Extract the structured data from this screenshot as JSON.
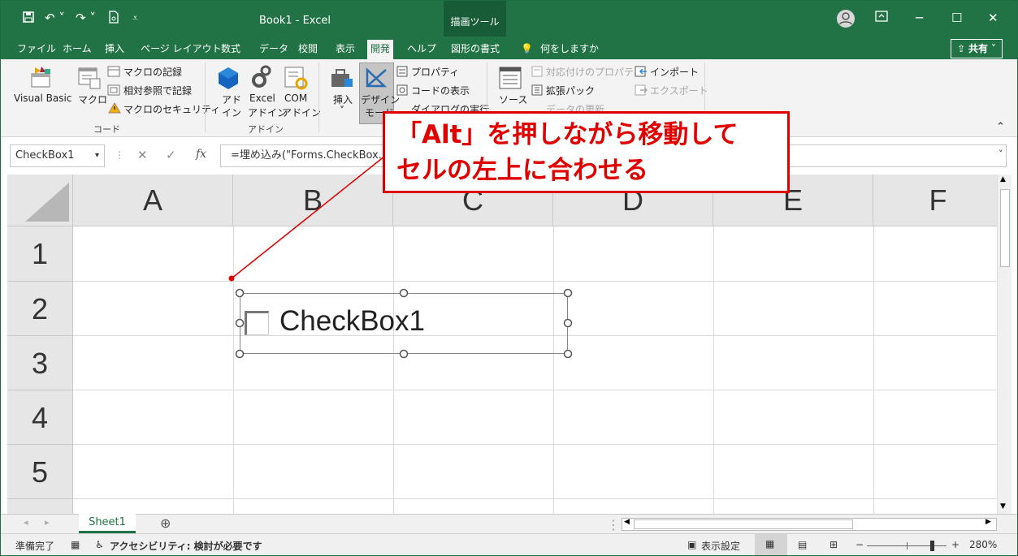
{
  "titlebar": {
    "doc_title": "Book1  -  Excel",
    "tool_tab": "描画ツール"
  },
  "menu": {
    "items": [
      "ファイル",
      "ホーム",
      "挿入",
      "ページ レイアウト",
      "数式",
      "データ",
      "校閲",
      "表示",
      "開発",
      "ヘルプ",
      "図形の書式"
    ],
    "active": "開発",
    "search": "何をしますか",
    "share": "共有"
  },
  "ribbon": {
    "visual_basic": "Visual Basic",
    "macro": "マクロ",
    "record_macro": "マクロの記録",
    "relative_ref": "相対参照で記録",
    "macro_security": "マクロのセキュリティ",
    "group_code": "コード",
    "addin_1": "アド",
    "addin_2": "イン",
    "excel_addin_1": "Excel",
    "excel_addin_2": "アドイン",
    "com_addin_1": "COM",
    "com_addin_2": "アドイン",
    "group_addin": "アドイン",
    "insert": "挿入",
    "design_mode_1": "デザイン",
    "design_mode_2": "モード",
    "properties": "プロパティ",
    "view_code": "コードの表示",
    "run_dialog": "ダイアログの実行",
    "source": "ソース",
    "map_properties": "対応付けのプロパティ",
    "expansion_packs": "拡張パック",
    "refresh_data": "データの更新",
    "import": "インポート",
    "export": "エクスポート"
  },
  "formula": {
    "namebox": "CheckBox1",
    "content": "=埋め込み(\"Forms.CheckBox.1\",\"\")"
  },
  "grid": {
    "columns": [
      "A",
      "B",
      "C",
      "D",
      "E",
      "F"
    ],
    "rows": [
      "1",
      "2",
      "3",
      "4",
      "5"
    ]
  },
  "checkbox": {
    "label": "CheckBox1",
    "checked": false
  },
  "callout": {
    "line1": "「Alt」を押しながら移動して",
    "line2": "セルの左上に合わせる"
  },
  "sheets": {
    "active": "Sheet1"
  },
  "status": {
    "ready": "準備完了",
    "accessibility": "アクセシビリティ: 検討が必要です",
    "display_settings": "表示設定",
    "zoom": "280%"
  },
  "colors": {
    "excel_green": "#217346",
    "callout_red": "#e00000"
  }
}
